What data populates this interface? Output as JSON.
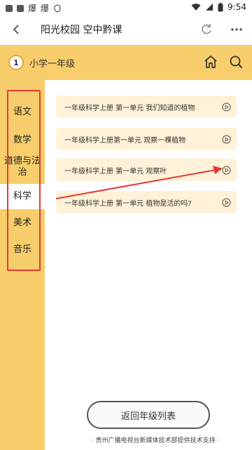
{
  "status_bar": {
    "app_text": "爆 爆",
    "time": "9:54"
  },
  "nav": {
    "title": "阳光校园 空中黔课"
  },
  "header": {
    "grade_number": "1",
    "grade_label": "小学一年级"
  },
  "sidebar": {
    "items": [
      {
        "label": "语文",
        "active": false
      },
      {
        "label": "数学",
        "active": false
      },
      {
        "label": "道德与法治",
        "active": false
      },
      {
        "label": "科学",
        "active": true
      },
      {
        "label": "美术",
        "active": false
      },
      {
        "label": "音乐",
        "active": false
      }
    ]
  },
  "lessons": [
    {
      "title": "一年级科学上册 第一单元 我们知道的植物"
    },
    {
      "title": "一年级科学上册第一单元 观察一棵植物"
    },
    {
      "title": "一年级科学上册 第一单元 观察叶"
    },
    {
      "title": "一年级科学上册 第一单元 植物是活的吗?"
    }
  ],
  "back_button": {
    "label": "返回年级列表"
  },
  "footer": {
    "text": "· 贵州广播电视台新媒体技术部提供技术支持 ·"
  },
  "colors": {
    "accent": "#f8cd6b",
    "lesson_bg": "#fff2d8",
    "annotation_red": "#e53935"
  }
}
